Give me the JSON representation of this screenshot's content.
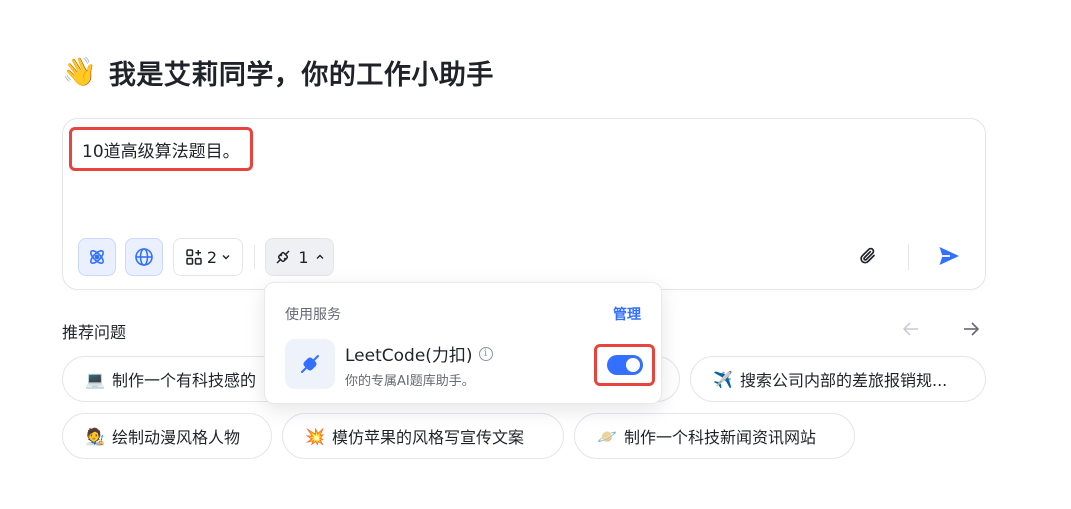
{
  "header": {
    "emoji": "👋",
    "title": "我是艾莉同学，你的工作小助手"
  },
  "composer": {
    "input_value": "10道高级算法题目。",
    "apps_count": "2",
    "plugin_count": "1"
  },
  "recommended": {
    "title": "推荐问题",
    "chips": [
      {
        "emoji": "💻",
        "label": "制作一个有科技感的"
      },
      {
        "emoji": "",
        "label": ""
      },
      {
        "emoji": "✈️",
        "label": "搜索公司内部的差旅报销规..."
      },
      {
        "emoji": "🧑‍🎨",
        "label": "绘制动漫风格人物"
      },
      {
        "emoji": "💥",
        "label": "模仿苹果的风格写宣传文案"
      },
      {
        "emoji": "🪐",
        "label": "制作一个科技新闻资讯网站"
      }
    ]
  },
  "services_popup": {
    "section_label": "使用服务",
    "manage_label": "管理",
    "service": {
      "name": "LeetCode(力扣)",
      "description": "你的专属AI题库助手。",
      "enabled": true
    }
  },
  "colors": {
    "accent": "#3370ff",
    "highlight": "#e8443e"
  }
}
